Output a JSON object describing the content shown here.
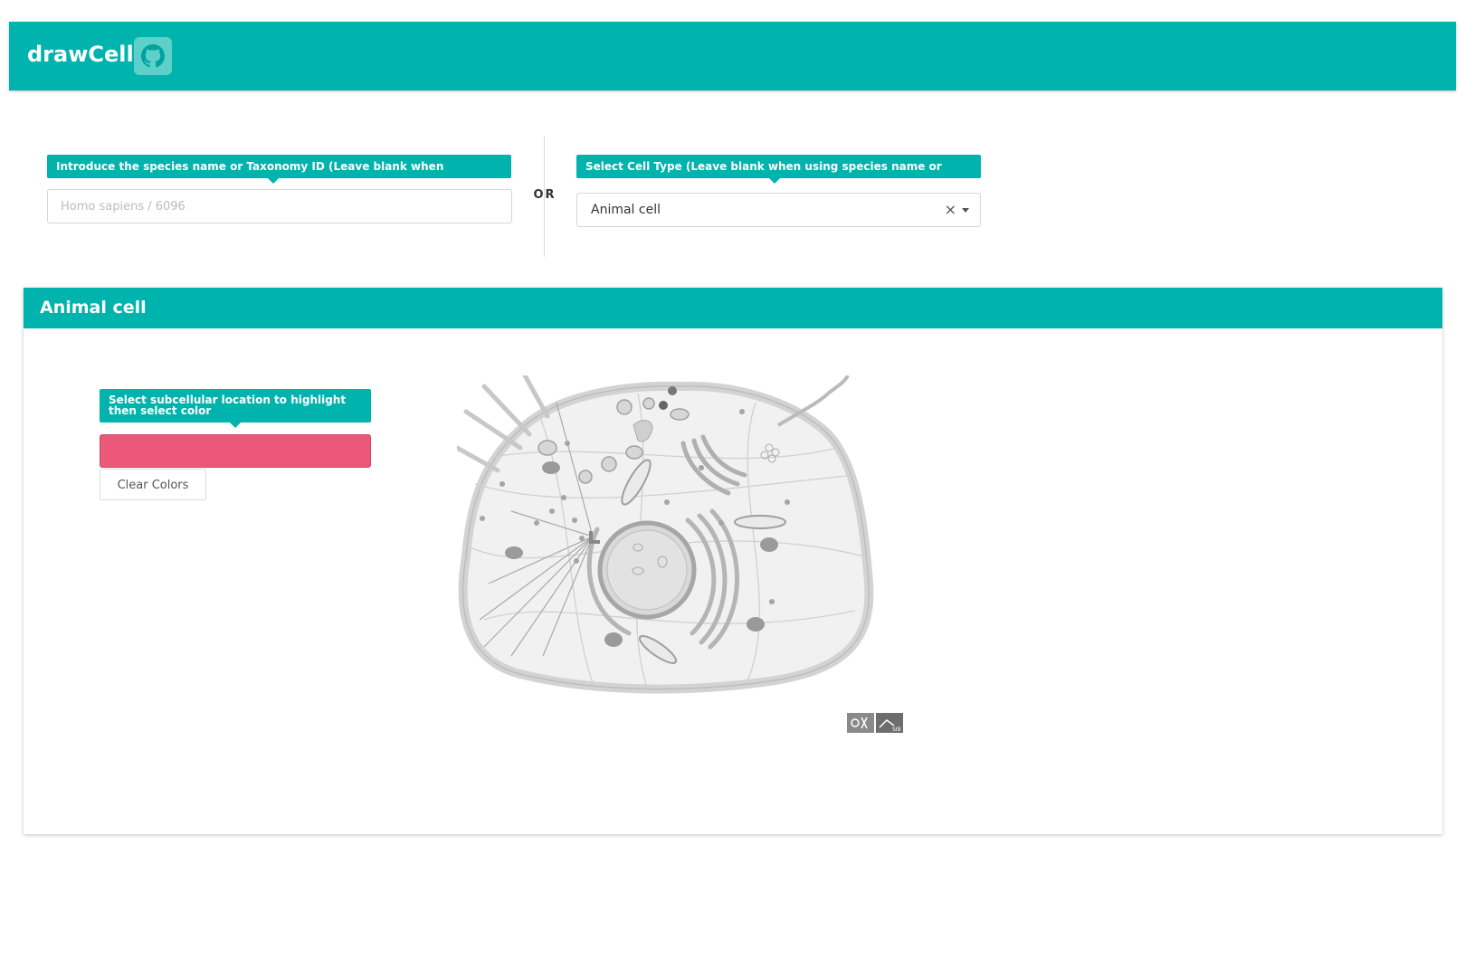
{
  "app": {
    "title": "drawCell"
  },
  "header": {
    "github_icon": "github-icon"
  },
  "species": {
    "label": "Introduce the species name or Taxonomy ID (Leave blank when selecting cell type)",
    "placeholder": "Homo sapiens / 6096",
    "value": ""
  },
  "divider": {
    "text": "OR"
  },
  "cell_type": {
    "label": "Select Cell Type (Leave blank when using species name or taxonomy ID)",
    "selected": "Animal cell",
    "clear_symbol": "×"
  },
  "panel": {
    "title": "Animal cell"
  },
  "highlight": {
    "label": "Select subcellular location to highlight then select color",
    "color": "#ec5879",
    "clear_button": "Clear Colors"
  },
  "colors": {
    "accent": "#00b3ac",
    "swatch": "#ec5879"
  }
}
